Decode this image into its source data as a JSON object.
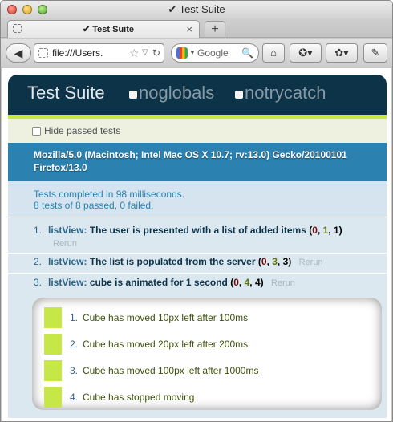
{
  "window": {
    "title": "✔ Test Suite"
  },
  "tabs": [
    {
      "title": "✔ Test Suite",
      "close": "×"
    }
  ],
  "new_tab_label": "+",
  "nav": {
    "back_label": "◀",
    "url": "file:///Users.",
    "search_engine": "Google",
    "search_icon": "magnifier-icon",
    "icons": [
      "back-arrow-icon",
      "star-icon",
      "reload-icon",
      "home-icon",
      "bookmarks-icon",
      "addon-icon",
      "tools-icon"
    ]
  },
  "qunit": {
    "title": "Test Suite",
    "options": [
      "noglobals",
      "notrycatch"
    ],
    "hide_passed": "Hide passed tests",
    "user_agent": "Mozilla/5.0 (Macintosh; Intel Mac OS X 10.7; rv:13.0) Gecko/20100101 Firefox/13.0",
    "results": {
      "line1": "Tests completed in 98 milliseconds.",
      "line2": "8 tests of 8 passed, 0 failed."
    },
    "tests": [
      {
        "num": "1.",
        "module": "listView:",
        "name": "The user is presented with a list of added items",
        "open": " (",
        "failed": "0",
        "sep1": ", ",
        "passed": "1",
        "sep2": ", ",
        "total": "1",
        "close": ")",
        "rerun": "Rerun"
      },
      {
        "num": "2.",
        "module": "listView:",
        "name": "The list is populated from the server",
        "open": " (",
        "failed": "0",
        "sep1": ", ",
        "passed": "3",
        "sep2": ", ",
        "total": "3",
        "close": ")",
        "rerun": "Rerun"
      },
      {
        "num": "3.",
        "module": "listView:",
        "name": "cube is animated for 1 second",
        "open": " (",
        "failed": "0",
        "sep1": ", ",
        "passed": "4",
        "sep2": ", ",
        "total": "4",
        "close": ")",
        "rerun": "Rerun"
      }
    ],
    "assertions": [
      {
        "num": "1.",
        "text": "Cube has moved 10px left after 100ms"
      },
      {
        "num": "2.",
        "text": "Cube has moved 20px left after 200ms"
      },
      {
        "num": "3.",
        "text": "Cube has moved 100px left after 1000ms"
      },
      {
        "num": "4.",
        "text": "Cube has stopped moving"
      }
    ],
    "colors": {
      "header_bg": "#0d3349",
      "banner_pass": "#c6e746",
      "useragent_bg": "#2b81af",
      "count_failed": "#710909",
      "count_passed": "#5e740b",
      "count_total": "#000000"
    }
  }
}
